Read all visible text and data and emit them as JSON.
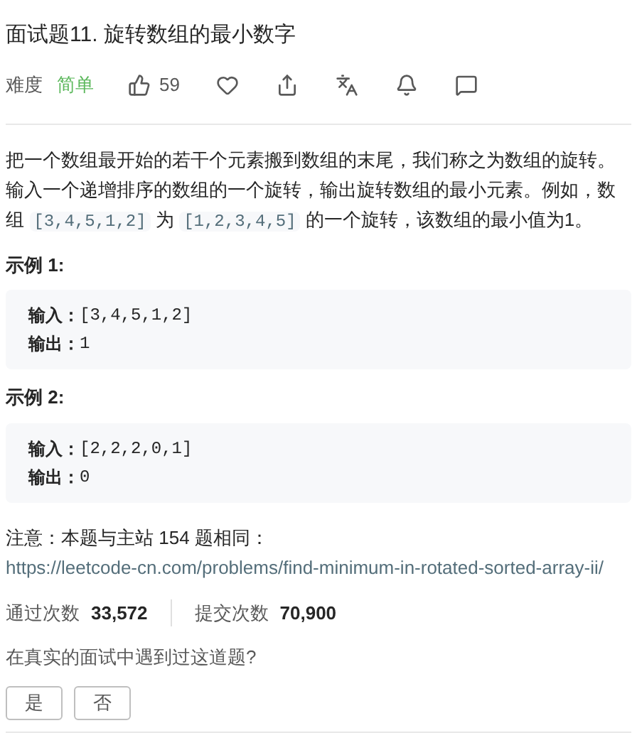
{
  "title": "面试题11. 旋转数组的最小数字",
  "meta": {
    "difficulty_label": "难度",
    "difficulty": "简单",
    "likes": "59"
  },
  "description": [
    {
      "kind": "text",
      "text": "把一个数组最开始的若干个元素搬到数组的末尾，我们称之为数组的旋转。输入一个递增排序的数组的一个旋转，输出旋转数组的最小元素。例如，数组 "
    },
    {
      "kind": "code",
      "text": "[3,4,5,1,2]"
    },
    {
      "kind": "text",
      "text": " 为 "
    },
    {
      "kind": "code",
      "text": "[1,2,3,4,5]"
    },
    {
      "kind": "text",
      "text": " 的一个旋转，该数组的最小值为1。"
    }
  ],
  "examples": [
    {
      "title": "示例 1:",
      "lines": [
        {
          "label": "输入：",
          "value": "[3,4,5,1,2]"
        },
        {
          "label": "输出：",
          "value": "1"
        }
      ]
    },
    {
      "title": "示例 2:",
      "lines": [
        {
          "label": "输入：",
          "value": "[2,2,2,0,1]"
        },
        {
          "label": "输出：",
          "value": "0"
        }
      ]
    }
  ],
  "note": {
    "text": "注意：本题与主站 154 题相同：",
    "link": "https://leetcode-cn.com/problems/find-minimum-in-rotated-sorted-array-ii/"
  },
  "stats": [
    {
      "label": "通过次数",
      "value": "33,572"
    },
    {
      "label": "提交次数",
      "value": "70,900"
    }
  ],
  "question": "在真实的面试中遇到过这道题?",
  "answers": [
    "是",
    "否"
  ]
}
